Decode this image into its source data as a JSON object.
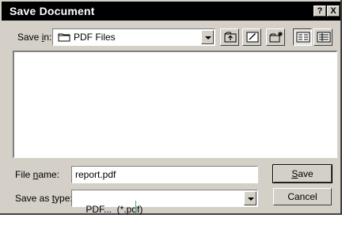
{
  "window": {
    "title": "Save Document"
  },
  "titlebar_buttons": {
    "help": "?",
    "close": "X"
  },
  "toolbar": {
    "look_in_label_prefix": "Save ",
    "look_in_label_accel": "i",
    "look_in_label_suffix": "n:",
    "current_folder": "PDF Files"
  },
  "form": {
    "file_name_label_prefix": "File ",
    "file_name_label_accel": "n",
    "file_name_label_suffix": "ame:",
    "file_name_value": "report.pdf",
    "save_type_label_prefix": "Save as ",
    "save_type_label_accel": "t",
    "save_type_label_suffix": "ype:",
    "save_type_value": "PDF...  (*.pdf)"
  },
  "buttons": {
    "save_accel": "S",
    "save_rest": "ave",
    "cancel": "Cancel"
  },
  "icons": [
    "folder-icon",
    "chevron-down-icon",
    "up-folder-icon",
    "desktop-icon",
    "new-folder-icon",
    "list-view-icon",
    "details-view-icon",
    "help-icon",
    "close-icon"
  ]
}
